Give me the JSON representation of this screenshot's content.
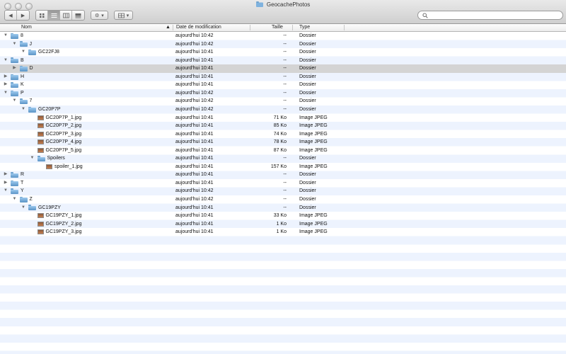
{
  "window": {
    "title": "GeocachePhotos"
  },
  "toolbar": {
    "back_icon": "chevron-left-icon",
    "forward_icon": "chevron-right-icon",
    "view_icons": [
      "icon-view-icon",
      "list-view-icon",
      "column-view-icon",
      "coverflow-view-icon"
    ],
    "action_icon": "gear-icon",
    "arrange_icon": "grid-icon"
  },
  "search": {
    "placeholder": "",
    "value": ""
  },
  "columns": {
    "name": "Nom",
    "date": "Date de modification",
    "size": "Taille",
    "type": "Type"
  },
  "rows": [
    {
      "name": "8",
      "date": "aujourd'hui 10:42",
      "size": "--",
      "type": "Dossier",
      "kind": "folder",
      "level": 0,
      "expanded": true
    },
    {
      "name": "J",
      "date": "aujourd'hui 10:42",
      "size": "--",
      "type": "Dossier",
      "kind": "folder",
      "level": 1,
      "expanded": true
    },
    {
      "name": "GC22FJ8",
      "date": "aujourd'hui 10:41",
      "size": "--",
      "type": "Dossier",
      "kind": "folder",
      "level": 2,
      "expanded": true
    },
    {
      "name": "B",
      "date": "aujourd'hui 10:41",
      "size": "--",
      "type": "Dossier",
      "kind": "folder",
      "level": 0,
      "expanded": true
    },
    {
      "name": "D",
      "date": "aujourd'hui 10:41",
      "size": "--",
      "type": "Dossier",
      "kind": "folder",
      "level": 1,
      "expanded": false,
      "selected": true
    },
    {
      "name": "H",
      "date": "aujourd'hui 10:41",
      "size": "--",
      "type": "Dossier",
      "kind": "folder",
      "level": 0,
      "expanded": false
    },
    {
      "name": "K",
      "date": "aujourd'hui 10:41",
      "size": "--",
      "type": "Dossier",
      "kind": "folder",
      "level": 0,
      "expanded": false
    },
    {
      "name": "P",
      "date": "aujourd'hui 10:42",
      "size": "--",
      "type": "Dossier",
      "kind": "folder",
      "level": 0,
      "expanded": true
    },
    {
      "name": "7",
      "date": "aujourd'hui 10:42",
      "size": "--",
      "type": "Dossier",
      "kind": "folder",
      "level": 1,
      "expanded": true
    },
    {
      "name": "GC20P7P",
      "date": "aujourd'hui 10:42",
      "size": "--",
      "type": "Dossier",
      "kind": "folder",
      "level": 2,
      "expanded": true
    },
    {
      "name": "GC20P7P_1.jpg",
      "date": "aujourd'hui 10:41",
      "size": "71 Ko",
      "type": "Image JPEG",
      "kind": "file",
      "level": 3
    },
    {
      "name": "GC20P7P_2.jpg",
      "date": "aujourd'hui 10:41",
      "size": "85 Ko",
      "type": "Image JPEG",
      "kind": "file",
      "level": 3
    },
    {
      "name": "GC20P7P_3.jpg",
      "date": "aujourd'hui 10:41",
      "size": "74 Ko",
      "type": "Image JPEG",
      "kind": "file",
      "level": 3
    },
    {
      "name": "GC20P7P_4.jpg",
      "date": "aujourd'hui 10:41",
      "size": "78 Ko",
      "type": "Image JPEG",
      "kind": "file",
      "level": 3
    },
    {
      "name": "GC20P7P_5.jpg",
      "date": "aujourd'hui 10:41",
      "size": "87 Ko",
      "type": "Image JPEG",
      "kind": "file",
      "level": 3
    },
    {
      "name": "Spoilers",
      "date": "aujourd'hui 10:41",
      "size": "--",
      "type": "Dossier",
      "kind": "folder",
      "level": 3,
      "expanded": true
    },
    {
      "name": "spoiler_1.jpg",
      "date": "aujourd'hui 10:41",
      "size": "157 Ko",
      "type": "Image JPEG",
      "kind": "file",
      "level": 4
    },
    {
      "name": "R",
      "date": "aujourd'hui 10:41",
      "size": "--",
      "type": "Dossier",
      "kind": "folder",
      "level": 0,
      "expanded": false
    },
    {
      "name": "T",
      "date": "aujourd'hui 10:41",
      "size": "--",
      "type": "Dossier",
      "kind": "folder",
      "level": 0,
      "expanded": false
    },
    {
      "name": "Y",
      "date": "aujourd'hui 10:42",
      "size": "--",
      "type": "Dossier",
      "kind": "folder",
      "level": 0,
      "expanded": true
    },
    {
      "name": "Z",
      "date": "aujourd'hui 10:42",
      "size": "--",
      "type": "Dossier",
      "kind": "folder",
      "level": 1,
      "expanded": true
    },
    {
      "name": "GC19PZY",
      "date": "aujourd'hui 10:41",
      "size": "--",
      "type": "Dossier",
      "kind": "folder",
      "level": 2,
      "expanded": true
    },
    {
      "name": "GC19PZY_1.jpg",
      "date": "aujourd'hui 10:41",
      "size": "33 Ko",
      "type": "Image JPEG",
      "kind": "file",
      "level": 3
    },
    {
      "name": "GC19PZY_2.jpg",
      "date": "aujourd'hui 10:41",
      "size": "1 Ko",
      "type": "Image JPEG",
      "kind": "file",
      "level": 3
    },
    {
      "name": "GC19PZY_3.jpg",
      "date": "aujourd'hui 10:41",
      "size": "1 Ko",
      "type": "Image JPEG",
      "kind": "file",
      "level": 3
    }
  ]
}
